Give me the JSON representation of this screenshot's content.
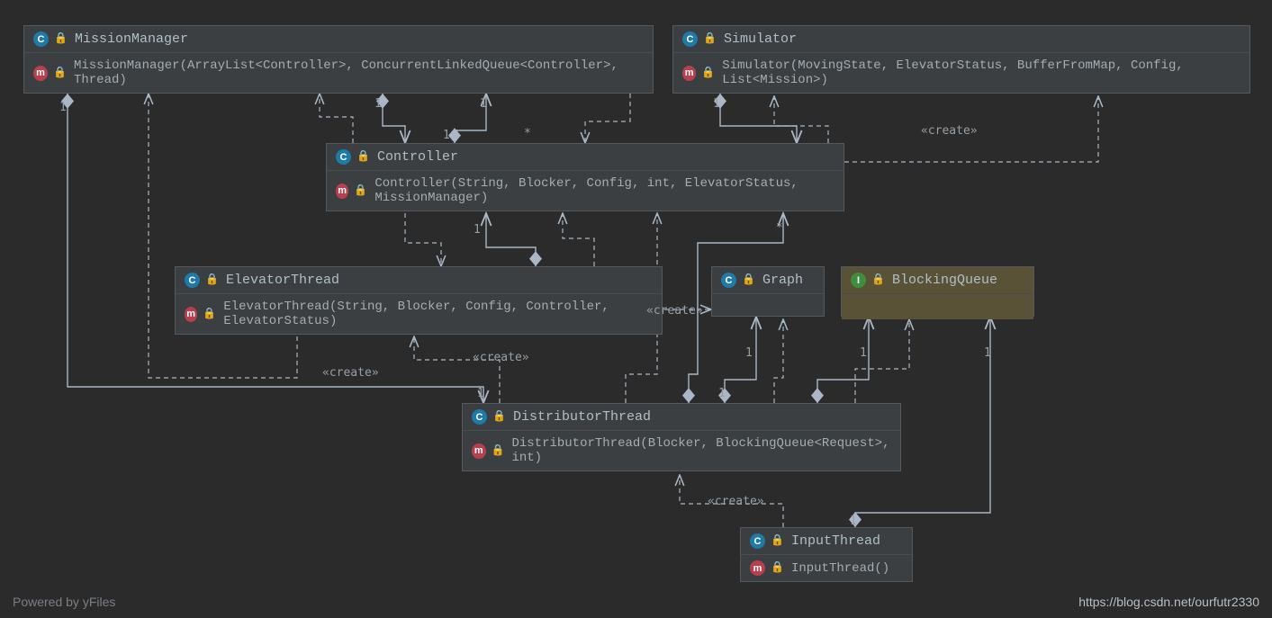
{
  "footer": {
    "left": "Powered by yFiles",
    "right": "https://blog.csdn.net/ourfutr2330"
  },
  "icons": {
    "class_letter": "C",
    "interface_letter": "I",
    "method_letter": "m",
    "lock_glyph": "🔒"
  },
  "stereotypes": {
    "create": "«create»"
  },
  "multiplicities": {
    "one": "1",
    "star": "*"
  },
  "classes": {
    "missionManager": {
      "name": "MissionManager",
      "constructor": "MissionManager(ArrayList<Controller>, ConcurrentLinkedQueue<Controller>, Thread)"
    },
    "simulator": {
      "name": "Simulator",
      "constructor": "Simulator(MovingState, ElevatorStatus, BufferFromMap, Config, List<Mission>)"
    },
    "controller": {
      "name": "Controller",
      "constructor": "Controller(String, Blocker, Config, int, ElevatorStatus, MissionManager)"
    },
    "elevatorThread": {
      "name": "ElevatorThread",
      "constructor": "ElevatorThread(String, Blocker, Config, Controller, ElevatorStatus)"
    },
    "graph": {
      "name": "Graph"
    },
    "blockingQueue": {
      "name": "BlockingQueue"
    },
    "distributorThread": {
      "name": "DistributorThread",
      "constructor": "DistributorThread(Blocker, BlockingQueue<Request>, int)"
    },
    "inputThread": {
      "name": "InputThread",
      "constructor": "InputThread()"
    }
  }
}
